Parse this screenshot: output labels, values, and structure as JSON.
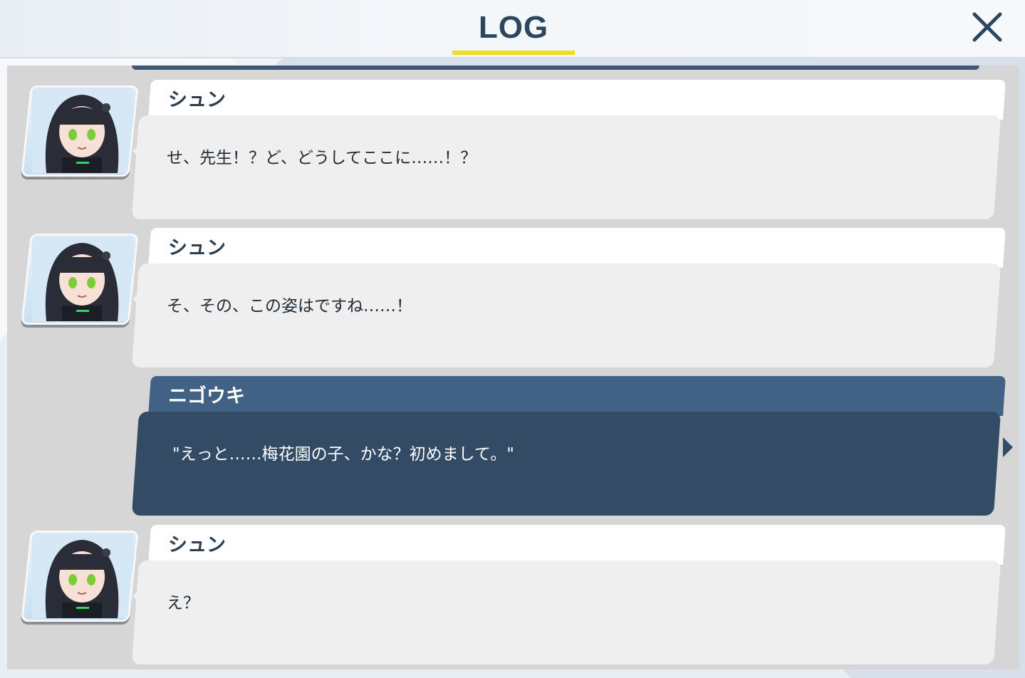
{
  "header": {
    "title": "LOG",
    "close_icon": "close-icon",
    "accent_color": "#f1dc1f"
  },
  "log": [
    {
      "speaker": "シュン",
      "text": "せ、先生！？ど、どうしてここに……！？",
      "is_player": false,
      "avatar": "shun-portrait"
    },
    {
      "speaker": "シュン",
      "text": "そ、その、この姿はですね……！",
      "is_player": false,
      "avatar": "shun-portrait"
    },
    {
      "speaker": "ニゴウキ",
      "text": "\"えっと……梅花園の子、かな？初めまして。\"",
      "is_player": true
    },
    {
      "speaker": "シュン",
      "text": "え？",
      "is_player": false,
      "avatar": "shun-portrait"
    }
  ]
}
